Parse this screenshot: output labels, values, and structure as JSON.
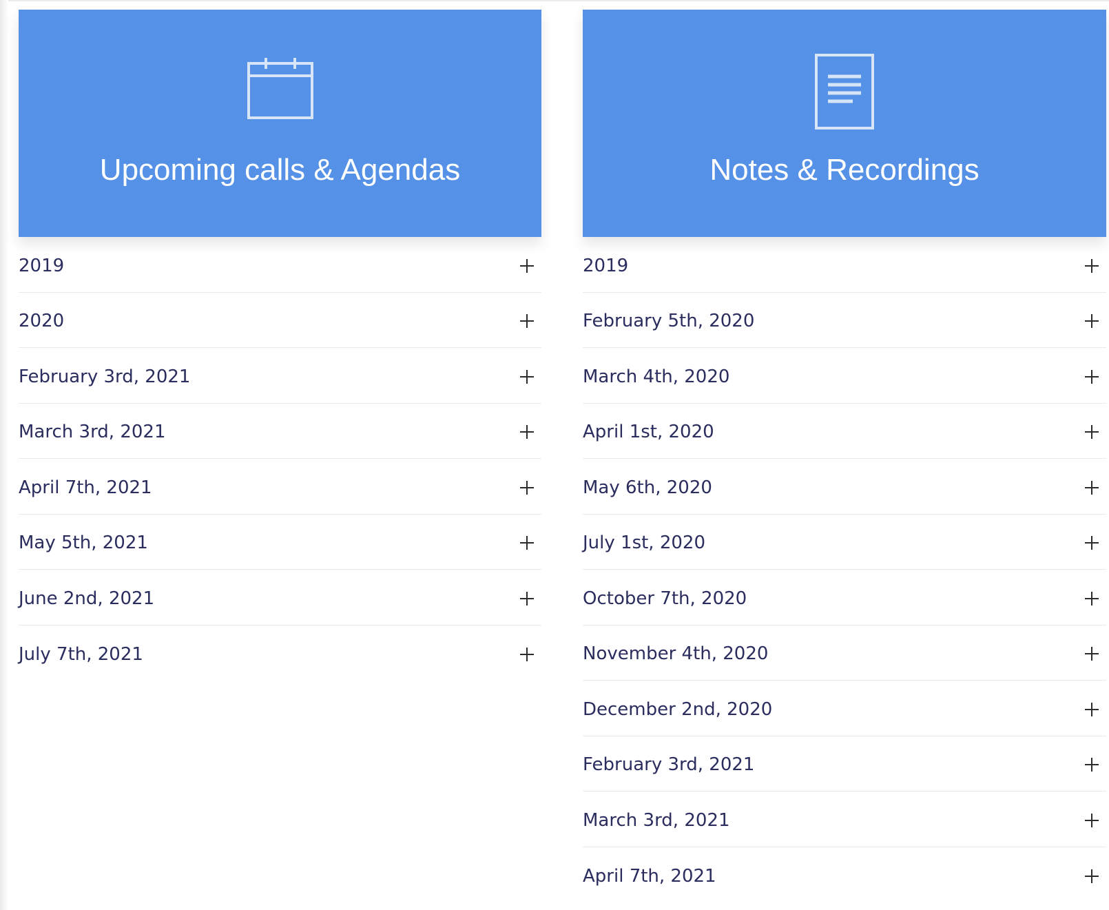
{
  "accent_color": "#5591e6",
  "text_color": "#2a2d5e",
  "left": {
    "title": "Upcoming calls & Agendas",
    "icon": "calendar-icon",
    "items": [
      {
        "label": "2019"
      },
      {
        "label": "2020"
      },
      {
        "label": "February 3rd, 2021"
      },
      {
        "label": "March 3rd, 2021"
      },
      {
        "label": "April 7th, 2021"
      },
      {
        "label": "May 5th, 2021"
      },
      {
        "label": "June 2nd, 2021"
      },
      {
        "label": "July 7th, 2021"
      }
    ]
  },
  "right": {
    "title": "Notes & Recordings",
    "icon": "document-icon",
    "items": [
      {
        "label": "2019"
      },
      {
        "label": "February 5th, 2020"
      },
      {
        "label": "March 4th, 2020"
      },
      {
        "label": "April 1st, 2020"
      },
      {
        "label": "May 6th, 2020"
      },
      {
        "label": "July 1st, 2020"
      },
      {
        "label": "October 7th, 2020"
      },
      {
        "label": "November 4th, 2020"
      },
      {
        "label": "December 2nd, 2020"
      },
      {
        "label": "February 3rd, 2021"
      },
      {
        "label": "March 3rd, 2021"
      },
      {
        "label": "April 7th, 2021"
      }
    ]
  }
}
